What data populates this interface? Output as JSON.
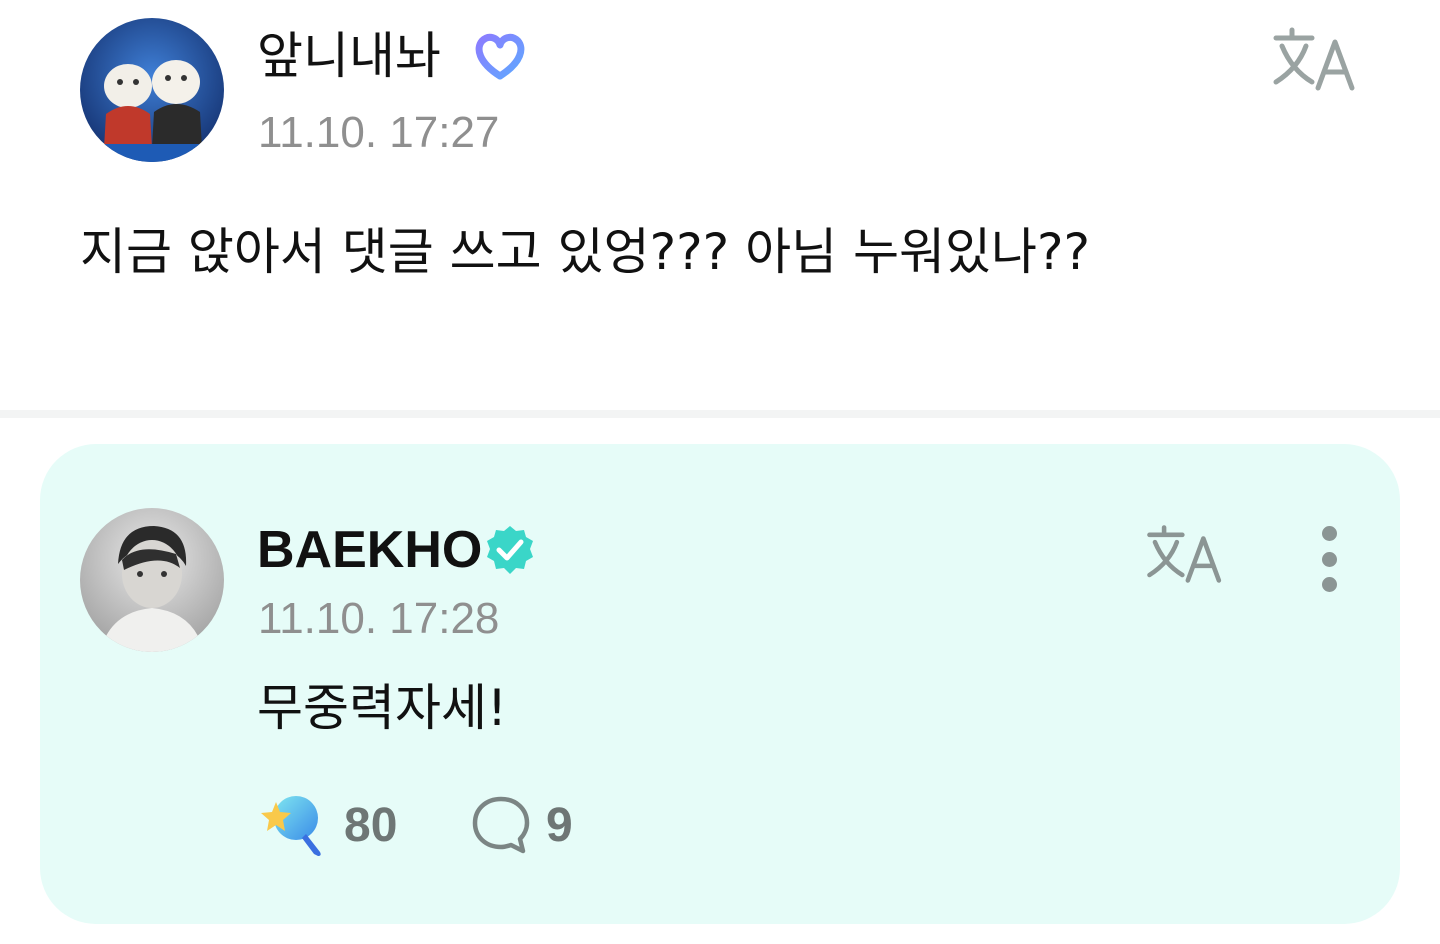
{
  "post": {
    "author": "앞니내놔",
    "timestamp": "11.10. 17:27",
    "text": "지금 앉아서 댓글 쓰고 있엉??? 아님 누워있나??",
    "icons": {
      "badge": "heart-badge-icon",
      "translate": "translate-icon",
      "avatar": "avatar-photo"
    }
  },
  "reply": {
    "author": "BAEKHO",
    "timestamp": "11.10. 17:28",
    "text": "무중력자세!",
    "reactions": {
      "cheer_count": "80",
      "comment_count": "9"
    },
    "icons": {
      "badge": "verified-badge-icon",
      "translate": "translate-icon",
      "more": "more-vertical-icon",
      "cheer": "star-wand-icon",
      "comment": "comment-bubble-icon"
    }
  },
  "colors": {
    "reply_background": "#e6fcf8",
    "verified_badge": "#3ad6c8",
    "timestamp": "#8f8f8f",
    "icon_gray": "#8b9594",
    "heart_badge_gradient": [
      "#8b7cff",
      "#5fa8ff"
    ]
  }
}
